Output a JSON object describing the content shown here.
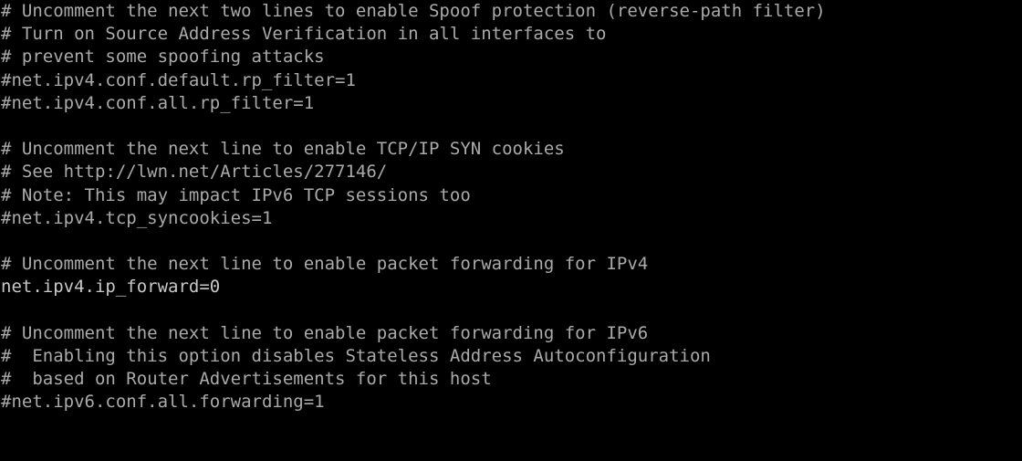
{
  "terminal": {
    "colors": {
      "background": "#000000",
      "comment": "#aaaaaa",
      "active": "#c8c8c8"
    },
    "lines": [
      {
        "text": "# Uncomment the next two lines to enable Spoof protection (reverse-path filter)",
        "kind": "comment"
      },
      {
        "text": "# Turn on Source Address Verification in all interfaces to",
        "kind": "comment"
      },
      {
        "text": "# prevent some spoofing attacks",
        "kind": "comment"
      },
      {
        "text": "#net.ipv4.conf.default.rp_filter=1",
        "kind": "comment"
      },
      {
        "text": "#net.ipv4.conf.all.rp_filter=1",
        "kind": "comment"
      },
      {
        "text": "",
        "kind": "blank"
      },
      {
        "text": "# Uncomment the next line to enable TCP/IP SYN cookies",
        "kind": "comment"
      },
      {
        "text": "# See http://lwn.net/Articles/277146/",
        "kind": "comment"
      },
      {
        "text": "# Note: This may impact IPv6 TCP sessions too",
        "kind": "comment"
      },
      {
        "text": "#net.ipv4.tcp_syncookies=1",
        "kind": "comment"
      },
      {
        "text": "",
        "kind": "blank"
      },
      {
        "text": "# Uncomment the next line to enable packet forwarding for IPv4",
        "kind": "comment"
      },
      {
        "text": "net.ipv4.ip_forward=0",
        "kind": "active"
      },
      {
        "text": "",
        "kind": "blank"
      },
      {
        "text": "# Uncomment the next line to enable packet forwarding for IPv6",
        "kind": "comment"
      },
      {
        "text": "#  Enabling this option disables Stateless Address Autoconfiguration",
        "kind": "comment"
      },
      {
        "text": "#  based on Router Advertisements for this host",
        "kind": "comment"
      },
      {
        "text": "#net.ipv6.conf.all.forwarding=1",
        "kind": "comment"
      }
    ]
  }
}
